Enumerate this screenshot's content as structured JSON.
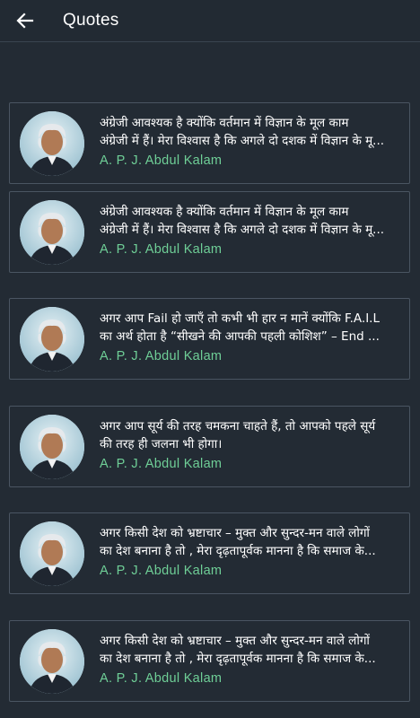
{
  "appbar": {
    "back_icon": "arrow-left-icon",
    "title": "Quotes"
  },
  "colors": {
    "background": "#232b34",
    "author": "#6fcf97",
    "card_border": "#4a5562"
  },
  "quotes": [
    {
      "line1": "अंग्रेजी आवश्यक है क्योंकि वर्तमान में विज्ञान के मूल काम",
      "line2": "अंग्रेजी में हैं। मेरा विश्वास है कि अगले दो दशक में विज्ञान के मू...",
      "author": "A. P. J. Abdul Kalam"
    },
    {
      "line1": "अंग्रेजी आवश्यक है क्योंकि वर्तमान में विज्ञान के मूल काम",
      "line2": "अंग्रेजी में हैं। मेरा विश्वास है कि अगले दो दशक में विज्ञान के मू...",
      "author": "A. P. J. Abdul Kalam"
    },
    {
      "line1": "अगर आप Fail हो जाएँ तो कभी भी हार न मानें क्योंकि F.A.I.L",
      "line2": "का अर्थ होता है “सीखने की आपकी पहली कोशिश” – End ...",
      "author": "A. P. J. Abdul Kalam"
    },
    {
      "line1": "अगर आप सूर्य की तरह चमकना चाहते हैं, तो आपको पहले सूर्य",
      "line2": "की तरह ही जलना भी होगा।",
      "author": "A. P. J. Abdul Kalam"
    },
    {
      "line1": "अगर किसी देश को भ्रष्टाचार – मुक्त और सुन्दर-मन वाले लोगों",
      "line2": "का देश बनाना है तो , मेरा दृढ़तापूर्वक  मानना है कि समाज के...",
      "author": "A. P. J. Abdul Kalam"
    },
    {
      "line1": "अगर किसी देश को भ्रष्टाचार – मुक्त और सुन्दर-मन वाले लोगों",
      "line2": "का देश बनाना है तो , मेरा दृढ़तापूर्वक  मानना है कि समाज के...",
      "author": "A. P. J. Abdul Kalam"
    }
  ]
}
